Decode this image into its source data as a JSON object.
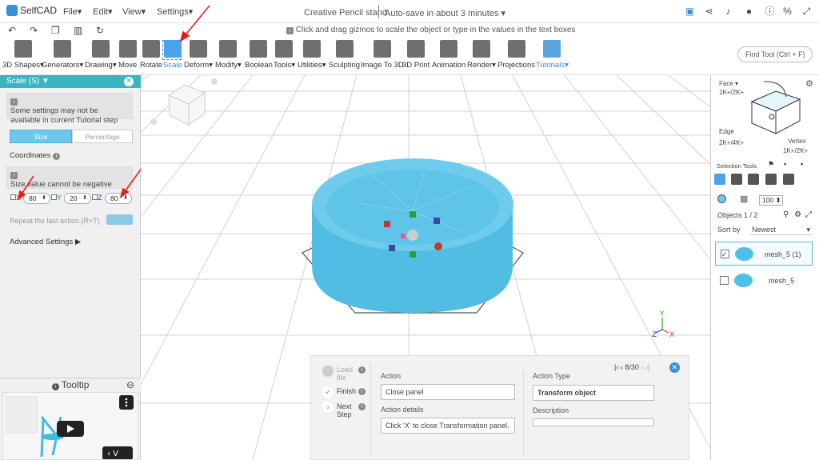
{
  "app": {
    "logo": "SelfCAD",
    "title": "Creative Pencil stand",
    "autosave": "Auto-save in about 3 minutes"
  },
  "menu": [
    {
      "label": "File"
    },
    {
      "label": "Edit"
    },
    {
      "label": "View"
    },
    {
      "label": "Settings"
    }
  ],
  "hint": "Click and drag gizmos to scale the object or type in the values in the text boxes",
  "toolbar": {
    "tools": [
      {
        "label": "3D Shapes"
      },
      {
        "label": "Generators"
      },
      {
        "label": "Drawing"
      },
      {
        "label": "Move"
      },
      {
        "label": "Rotate"
      },
      {
        "label": "Scale"
      },
      {
        "label": "Deform"
      },
      {
        "label": "Modify"
      },
      {
        "label": "Boolean"
      },
      {
        "label": "Tools"
      },
      {
        "label": "Utilities"
      },
      {
        "label": "Sculpting"
      },
      {
        "label": "Image To 3D"
      },
      {
        "label": "3D Print"
      },
      {
        "label": "Animation"
      },
      {
        "label": "Render"
      },
      {
        "label": "Projections"
      },
      {
        "label": "Tutorials"
      }
    ],
    "find_tool": "Find Tool (Ctrl + F)"
  },
  "scale_panel": {
    "header": "Scale (S)",
    "notice1": "Some settings may not be available in current Tutorial step",
    "seg_size": "Size",
    "seg_percentage": "Percentage",
    "coordinates": "Coordinates",
    "notice2": "Size value cannot be negative",
    "x_label": "X",
    "x_value": "80",
    "y_label": "Y",
    "y_value": "20",
    "z_label": "Z",
    "z_value": "80",
    "repeat": "Repeat the last action (R+T)",
    "advanced": "Advanced Settings"
  },
  "tooltip": {
    "header": "Tooltip"
  },
  "right_panel": {
    "face": "Face",
    "face_keys": "1K+/2K+",
    "edge": "Edge",
    "edge_keys": "2K+/4K+",
    "vertex": "Vertex",
    "vertex_keys": "1K+/2K+",
    "selection_tools": "Selection Tools",
    "percent": "100",
    "objects": "Objects 1 / 2",
    "sort_by": "Sort by",
    "sort_value": "Newest",
    "objects_list": [
      {
        "name": "mesh_5 (1)",
        "checked": true
      },
      {
        "name": "mesh_5",
        "checked": false
      }
    ]
  },
  "tutorial": {
    "step_load": "Load file",
    "step_finish": "Finish",
    "step_next": "Next Step",
    "pager": "8/30",
    "action_label": "Action",
    "action_value": "Close panel",
    "action_type_label": "Action Type",
    "action_type_value": "Transform object",
    "details_label": "Action details",
    "details_value": "Click 'X' to close Transformation panel.",
    "description_label": "Description",
    "description_value": ""
  },
  "axes": {
    "y": "Y",
    "z": "Z",
    "x": "X"
  },
  "colors": {
    "accent": "#3a8fd9",
    "header_teal": "#3ab4c0",
    "object": "#4cc0e6",
    "arrow": "#e02020"
  }
}
